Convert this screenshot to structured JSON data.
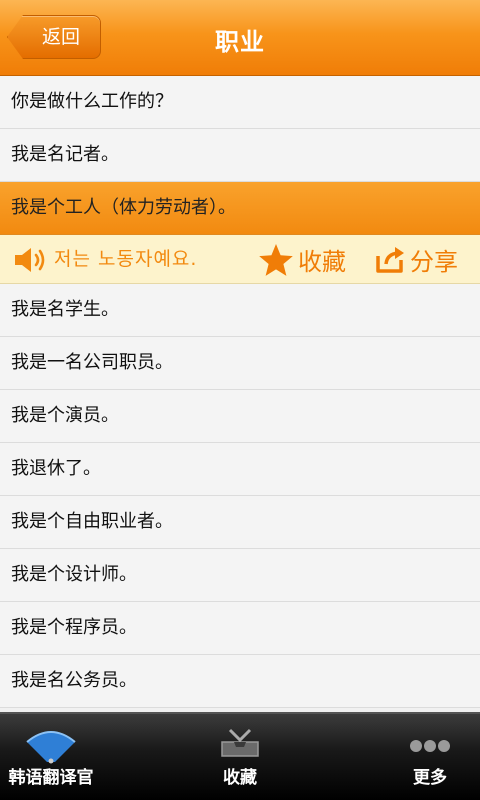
{
  "header": {
    "back_label": "返回",
    "title": "职业"
  },
  "phrases": [
    "你是做什么工作的？",
    "我是名记者。",
    "我是个工人（体力劳动者）。",
    "我是名学生。",
    "我是一名公司职员。",
    "我是个演员。",
    "我退休了。",
    "我是个自由职业者。",
    "我是个设计师。",
    "我是个程序员。",
    "我是名公务员。"
  ],
  "selected": {
    "korean": "저는 노동자예요.",
    "favorite_label": "收藏",
    "share_label": "分享"
  },
  "tabs": {
    "translator": "韩语翻译官",
    "favorites": "收藏",
    "more": "更多"
  },
  "colors": {
    "accent": "#f28a10",
    "header": "#f8941a",
    "action_bar_bg": "#fdf3cc"
  }
}
